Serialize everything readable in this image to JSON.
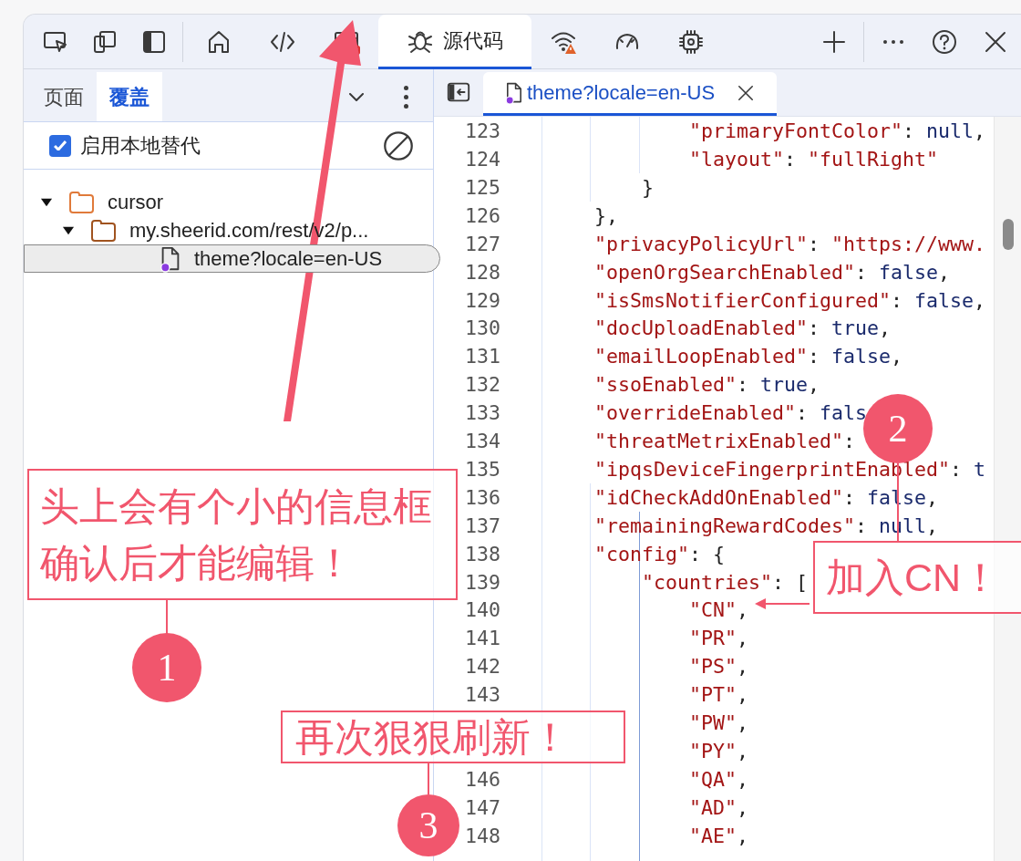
{
  "toolbar": {
    "items": [
      {
        "kind": "inspect",
        "selected": false
      },
      {
        "kind": "device",
        "selected": false
      },
      {
        "kind": "dock",
        "selected": false
      },
      {
        "kind": "home",
        "selected": false
      },
      {
        "kind": "elements",
        "selected": false
      },
      {
        "kind": "network",
        "selected": false
      },
      {
        "kind": "sources",
        "label": "源代码",
        "selected": true
      },
      {
        "kind": "conditions",
        "selected": false
      },
      {
        "kind": "performance",
        "selected": false
      },
      {
        "kind": "memory",
        "selected": false
      }
    ]
  },
  "navigator": {
    "tabs": [
      {
        "label": "页面",
        "selected": false
      },
      {
        "label": "覆盖",
        "selected": true
      }
    ],
    "enable_overrides": {
      "label": "启用本地替代",
      "checked": true
    },
    "tree": [
      {
        "kind": "folder",
        "label": "cursor",
        "expanded": true,
        "children": [
          {
            "kind": "folder",
            "label": "my.sheerid.com/rest/v2/p...",
            "expanded": true,
            "children": [
              {
                "kind": "file",
                "label": "theme?locale=en-US",
                "selected": true
              }
            ]
          }
        ]
      }
    ]
  },
  "editor": {
    "tabs": [
      {
        "label": "theme?locale=en-US",
        "selected": true
      }
    ],
    "lines": [
      {
        "number": "123",
        "tokens": [
          {
            "kind": "key",
            "text": "            \"primaryFontColor\""
          },
          {
            "kind": "punct",
            "text": ": "
          },
          {
            "kind": "literal",
            "text": "null"
          },
          {
            "kind": "punct",
            "text": ","
          }
        ]
      },
      {
        "number": "124",
        "tokens": [
          {
            "kind": "key",
            "text": "            \"layout\""
          },
          {
            "kind": "punct",
            "text": ": "
          },
          {
            "kind": "string",
            "text": "\"fullRight\""
          }
        ]
      },
      {
        "number": "125",
        "tokens": [
          {
            "kind": "punct",
            "text": "        }"
          }
        ]
      },
      {
        "number": "126",
        "tokens": [
          {
            "kind": "punct",
            "text": "    },"
          }
        ]
      },
      {
        "number": "127",
        "tokens": [
          {
            "kind": "key",
            "text": "    \"privacyPolicyUrl\""
          },
          {
            "kind": "punct",
            "text": ": "
          },
          {
            "kind": "string",
            "text": "\"https://www."
          }
        ]
      },
      {
        "number": "128",
        "tokens": [
          {
            "kind": "key",
            "text": "    \"openOrgSearchEnabled\""
          },
          {
            "kind": "punct",
            "text": ": "
          },
          {
            "kind": "literal",
            "text": "false"
          },
          {
            "kind": "punct",
            "text": ","
          }
        ]
      },
      {
        "number": "129",
        "tokens": [
          {
            "kind": "key",
            "text": "    \"isSmsNotifierConfigured\""
          },
          {
            "kind": "punct",
            "text": ": "
          },
          {
            "kind": "literal",
            "text": "false"
          },
          {
            "kind": "punct",
            "text": ","
          }
        ]
      },
      {
        "number": "130",
        "tokens": [
          {
            "kind": "key",
            "text": "    \"docUploadEnabled\""
          },
          {
            "kind": "punct",
            "text": ": "
          },
          {
            "kind": "literal",
            "text": "true"
          },
          {
            "kind": "punct",
            "text": ","
          }
        ]
      },
      {
        "number": "131",
        "tokens": [
          {
            "kind": "key",
            "text": "    \"emailLoopEnabled\""
          },
          {
            "kind": "punct",
            "text": ": "
          },
          {
            "kind": "literal",
            "text": "false"
          },
          {
            "kind": "punct",
            "text": ","
          }
        ]
      },
      {
        "number": "132",
        "tokens": [
          {
            "kind": "key",
            "text": "    \"ssoEnabled\""
          },
          {
            "kind": "punct",
            "text": ": "
          },
          {
            "kind": "literal",
            "text": "true"
          },
          {
            "kind": "punct",
            "text": ","
          }
        ]
      },
      {
        "number": "133",
        "tokens": [
          {
            "kind": "key",
            "text": "    \"overrideEnabled\""
          },
          {
            "kind": "punct",
            "text": ": "
          },
          {
            "kind": "literal",
            "text": "fals"
          }
        ]
      },
      {
        "number": "134",
        "tokens": [
          {
            "kind": "key",
            "text": "    \"threatMetrixEnabled\""
          },
          {
            "kind": "punct",
            "text": ":"
          }
        ]
      },
      {
        "number": "135",
        "tokens": [
          {
            "kind": "key",
            "text": "    \"ipqsDeviceFingerprintEnabled\""
          },
          {
            "kind": "punct",
            "text": ": "
          },
          {
            "kind": "literal",
            "text": "t"
          }
        ]
      },
      {
        "number": "136",
        "tokens": [
          {
            "kind": "key",
            "text": "    \"idCheckAddOnEnabled\""
          },
          {
            "kind": "punct",
            "text": ": "
          },
          {
            "kind": "literal",
            "text": "false"
          },
          {
            "kind": "punct",
            "text": ","
          }
        ]
      },
      {
        "number": "137",
        "tokens": [
          {
            "kind": "key",
            "text": "    \"remainingRewardCodes\""
          },
          {
            "kind": "punct",
            "text": ": "
          },
          {
            "kind": "literal",
            "text": "null"
          },
          {
            "kind": "punct",
            "text": ","
          }
        ]
      },
      {
        "number": "138",
        "tokens": [
          {
            "kind": "key",
            "text": "    \"config\""
          },
          {
            "kind": "punct",
            "text": ": {"
          }
        ]
      },
      {
        "number": "139",
        "tokens": [
          {
            "kind": "key",
            "text": "        \"countries\""
          },
          {
            "kind": "punct",
            "text": ": ["
          }
        ]
      },
      {
        "number": "140",
        "tokens": [
          {
            "kind": "string",
            "text": "            \"CN\""
          },
          {
            "kind": "punct",
            "text": ","
          }
        ]
      },
      {
        "number": "141",
        "tokens": [
          {
            "kind": "string",
            "text": "            \"PR\""
          },
          {
            "kind": "punct",
            "text": ","
          }
        ]
      },
      {
        "number": "142",
        "tokens": [
          {
            "kind": "string",
            "text": "            \"PS\""
          },
          {
            "kind": "punct",
            "text": ","
          }
        ]
      },
      {
        "number": "143",
        "tokens": [
          {
            "kind": "string",
            "text": "            \"PT\""
          },
          {
            "kind": "punct",
            "text": ","
          }
        ]
      },
      {
        "tokens": [
          {
            "kind": "string",
            "text": "            \"PW\""
          },
          {
            "kind": "punct",
            "text": ","
          }
        ]
      },
      {
        "tokens": [
          {
            "kind": "string",
            "text": "            \"PY\""
          },
          {
            "kind": "punct",
            "text": ","
          }
        ]
      },
      {
        "number": "146",
        "tokens": [
          {
            "kind": "string",
            "text": "            \"QA\""
          },
          {
            "kind": "punct",
            "text": ","
          }
        ]
      },
      {
        "number": "147",
        "tokens": [
          {
            "kind": "string",
            "text": "            \"AD\""
          },
          {
            "kind": "punct",
            "text": ","
          }
        ]
      },
      {
        "number": "148",
        "tokens": [
          {
            "kind": "string",
            "text": "            \"AE\""
          },
          {
            "kind": "punct",
            "text": ","
          }
        ]
      }
    ]
  },
  "annotations": [
    {
      "number": "1",
      "lines": [
        "头上会有个小的信息框",
        "确认后才能编辑！"
      ]
    },
    {
      "number": "2",
      "lines": [
        "加入CN！"
      ]
    },
    {
      "number": "3",
      "lines": [
        "再次狠狠刷新！"
      ]
    }
  ]
}
